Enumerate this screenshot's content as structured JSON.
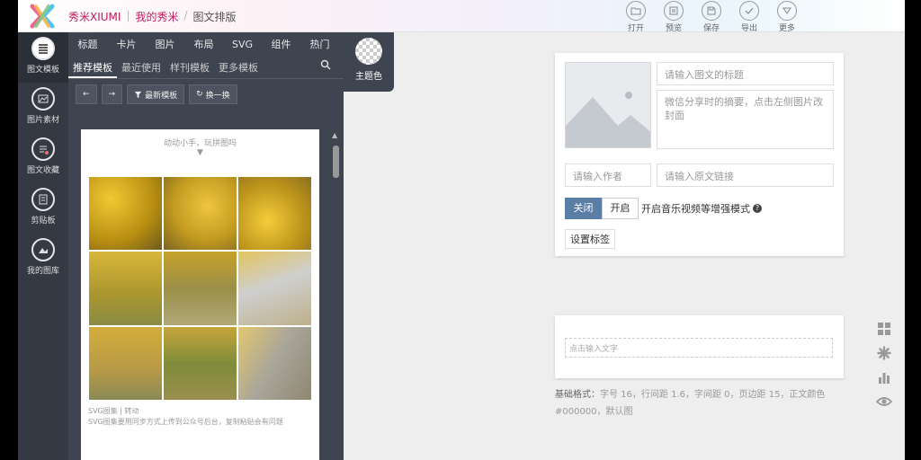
{
  "header": {
    "brand": "秀米XIUMI",
    "crumb_mine": "我的秀米",
    "crumb_current": "图文排版",
    "tools": [
      {
        "label": "打开",
        "icon": "folder-icon"
      },
      {
        "label": "预览",
        "icon": "preview-icon"
      },
      {
        "label": "保存",
        "icon": "save-icon"
      },
      {
        "label": "导出",
        "icon": "export-icon"
      },
      {
        "label": "更多",
        "icon": "more-icon"
      }
    ]
  },
  "sidebar": {
    "items": [
      {
        "label": "图文模板",
        "icon": "template-icon"
      },
      {
        "label": "图片素材",
        "icon": "image-material-icon"
      },
      {
        "label": "图文收藏",
        "icon": "favorites-icon"
      },
      {
        "label": "剪贴板",
        "icon": "clipboard-icon"
      },
      {
        "label": "我的图库",
        "icon": "gallery-icon"
      }
    ]
  },
  "categories": [
    "标题",
    "卡片",
    "图片",
    "布局",
    "SVG",
    "组件",
    "热门"
  ],
  "subtabs": [
    "推荐模板",
    "最近使用",
    "样刊模板",
    "更多模板"
  ],
  "buttons": {
    "newest": "最新模板",
    "refresh": "换一换"
  },
  "theme": {
    "label": "主题色"
  },
  "template_card": {
    "hint": "动动小手，玩拼图吗",
    "arrow": "▼",
    "foot_line1": "SVG图集 | 转动",
    "foot_line2": "SVG图集要用同步方式上传到公众号后台，复制粘贴会有问题"
  },
  "form": {
    "title_placeholder": "请输入图文的标题",
    "summary_placeholder": "微信分享时的摘要，点击左侧图片改封面",
    "author_placeholder": "请输入作者",
    "link_placeholder": "请输入原文链接",
    "toggle_off": "关闭",
    "toggle_on": "开启",
    "mode_text": "开启音乐视频等增强模式",
    "help": "?",
    "tag_button": "设置标签"
  },
  "editor": {
    "placeholder": "点击输入文字",
    "base_label": "基础格式：",
    "base_text": "字号 16，行间距 1.6，字间距 0，页边距 15，正文颜色 #000000，默认图"
  },
  "colors": {
    "accent": "#c2185b",
    "panel": "#3e4450",
    "toggle_active": "#5b7ea6"
  }
}
